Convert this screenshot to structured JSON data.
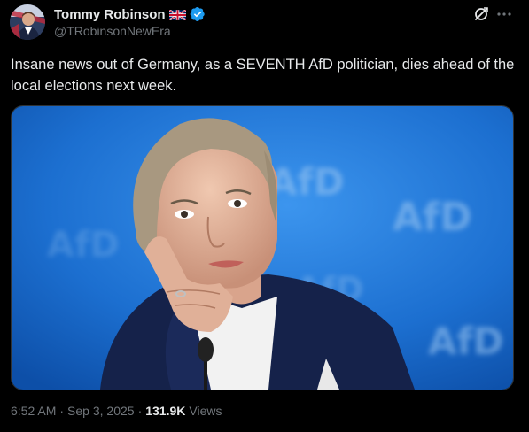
{
  "author": {
    "display_name": "Tommy Robinson",
    "handle": "@TRobinsonNewEra",
    "flag_icon": "uk-flag-icon",
    "verified_icon": "verified-badge-icon",
    "verified_color": "#1d9bf0"
  },
  "header_actions": {
    "grok_icon": "grok-icon",
    "more_icon": "more-options-icon"
  },
  "post": {
    "text": "Insane news out of Germany, as a SEVENTH AfD politician, dies ahead of the local elections next week.",
    "media_watermark": "AfD"
  },
  "meta": {
    "time": "6:52 AM",
    "separator": "·",
    "date": "Sep 3, 2025",
    "views_count": "131.9K",
    "views_label": "Views"
  },
  "colors": {
    "background": "#000000",
    "text_primary": "#e7e9ea",
    "text_secondary": "#71767b",
    "media_blue": "#1c6fd0"
  }
}
